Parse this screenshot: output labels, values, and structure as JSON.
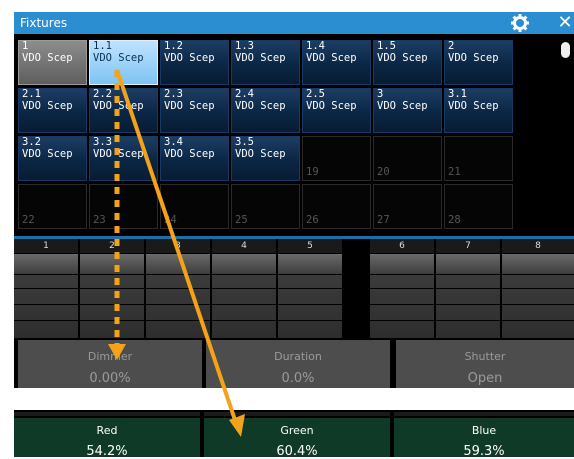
{
  "window": {
    "title": "Fixtures",
    "close_glyph": "✕",
    "gear_icon": "gear-icon"
  },
  "fixtures": [
    {
      "id": "1",
      "name": "VDO Scep",
      "state": "gray"
    },
    {
      "id": "1.1",
      "name": "VDO Scep",
      "state": "selected"
    },
    {
      "id": "1.2",
      "name": "VDO Scep",
      "state": "filled"
    },
    {
      "id": "1.3",
      "name": "VDO Scep",
      "state": "filled"
    },
    {
      "id": "1.4",
      "name": "VDO Scep",
      "state": "filled"
    },
    {
      "id": "1.5",
      "name": "VDO Scep",
      "state": "filled"
    },
    {
      "id": "2",
      "name": "VDO Scep",
      "state": "filled"
    },
    {
      "id": "",
      "name": "",
      "state": "none"
    },
    {
      "id": "2.1",
      "name": "VDO Scep",
      "state": "filled"
    },
    {
      "id": "2.2",
      "name": "VDO Scep",
      "state": "filled"
    },
    {
      "id": "2.3",
      "name": "VDO Scep",
      "state": "filled"
    },
    {
      "id": "2.4",
      "name": "VDO Scep",
      "state": "filled"
    },
    {
      "id": "2.5",
      "name": "VDO Scep",
      "state": "filled"
    },
    {
      "id": "3",
      "name": "VDO Scep",
      "state": "filled"
    },
    {
      "id": "3.1",
      "name": "VDO Scep",
      "state": "filled"
    },
    {
      "id": "",
      "name": "",
      "state": "none"
    },
    {
      "id": "3.2",
      "name": "VDO Scep",
      "state": "filled"
    },
    {
      "id": "3.3",
      "name": "VDO Scep",
      "state": "filled"
    },
    {
      "id": "3.4",
      "name": "VDO Scep",
      "state": "filled"
    },
    {
      "id": "3.5",
      "name": "VDO Scep",
      "state": "filled"
    },
    {
      "id": "19",
      "name": "",
      "state": "empty"
    },
    {
      "id": "20",
      "name": "",
      "state": "empty"
    },
    {
      "id": "21",
      "name": "",
      "state": "empty"
    },
    {
      "id": "",
      "name": "",
      "state": "none"
    },
    {
      "id": "22",
      "name": "",
      "state": "empty"
    },
    {
      "id": "23",
      "name": "",
      "state": "empty"
    },
    {
      "id": "24",
      "name": "",
      "state": "empty"
    },
    {
      "id": "25",
      "name": "",
      "state": "empty"
    },
    {
      "id": "26",
      "name": "",
      "state": "empty"
    },
    {
      "id": "27",
      "name": "",
      "state": "empty"
    },
    {
      "id": "28",
      "name": "",
      "state": "empty"
    },
    {
      "id": "",
      "name": "",
      "state": "none"
    }
  ],
  "executors": {
    "columns": [
      "1",
      "2",
      "3",
      "4",
      "5",
      "6",
      "7",
      "8"
    ]
  },
  "params": [
    {
      "label": "Dimmer",
      "value": "0.00%"
    },
    {
      "label": "Duration",
      "value": "0.0%"
    },
    {
      "label": "Shutter",
      "value": "Open"
    }
  ],
  "color_params": [
    {
      "label": "Red",
      "value": "54.2%"
    },
    {
      "label": "Green",
      "value": "60.4%"
    },
    {
      "label": "Blue",
      "value": "59.3%"
    }
  ],
  "colors": {
    "accent": "#2b8ed0",
    "arrow": "#f5a21b",
    "color_param_bg": "#0f3a27"
  }
}
